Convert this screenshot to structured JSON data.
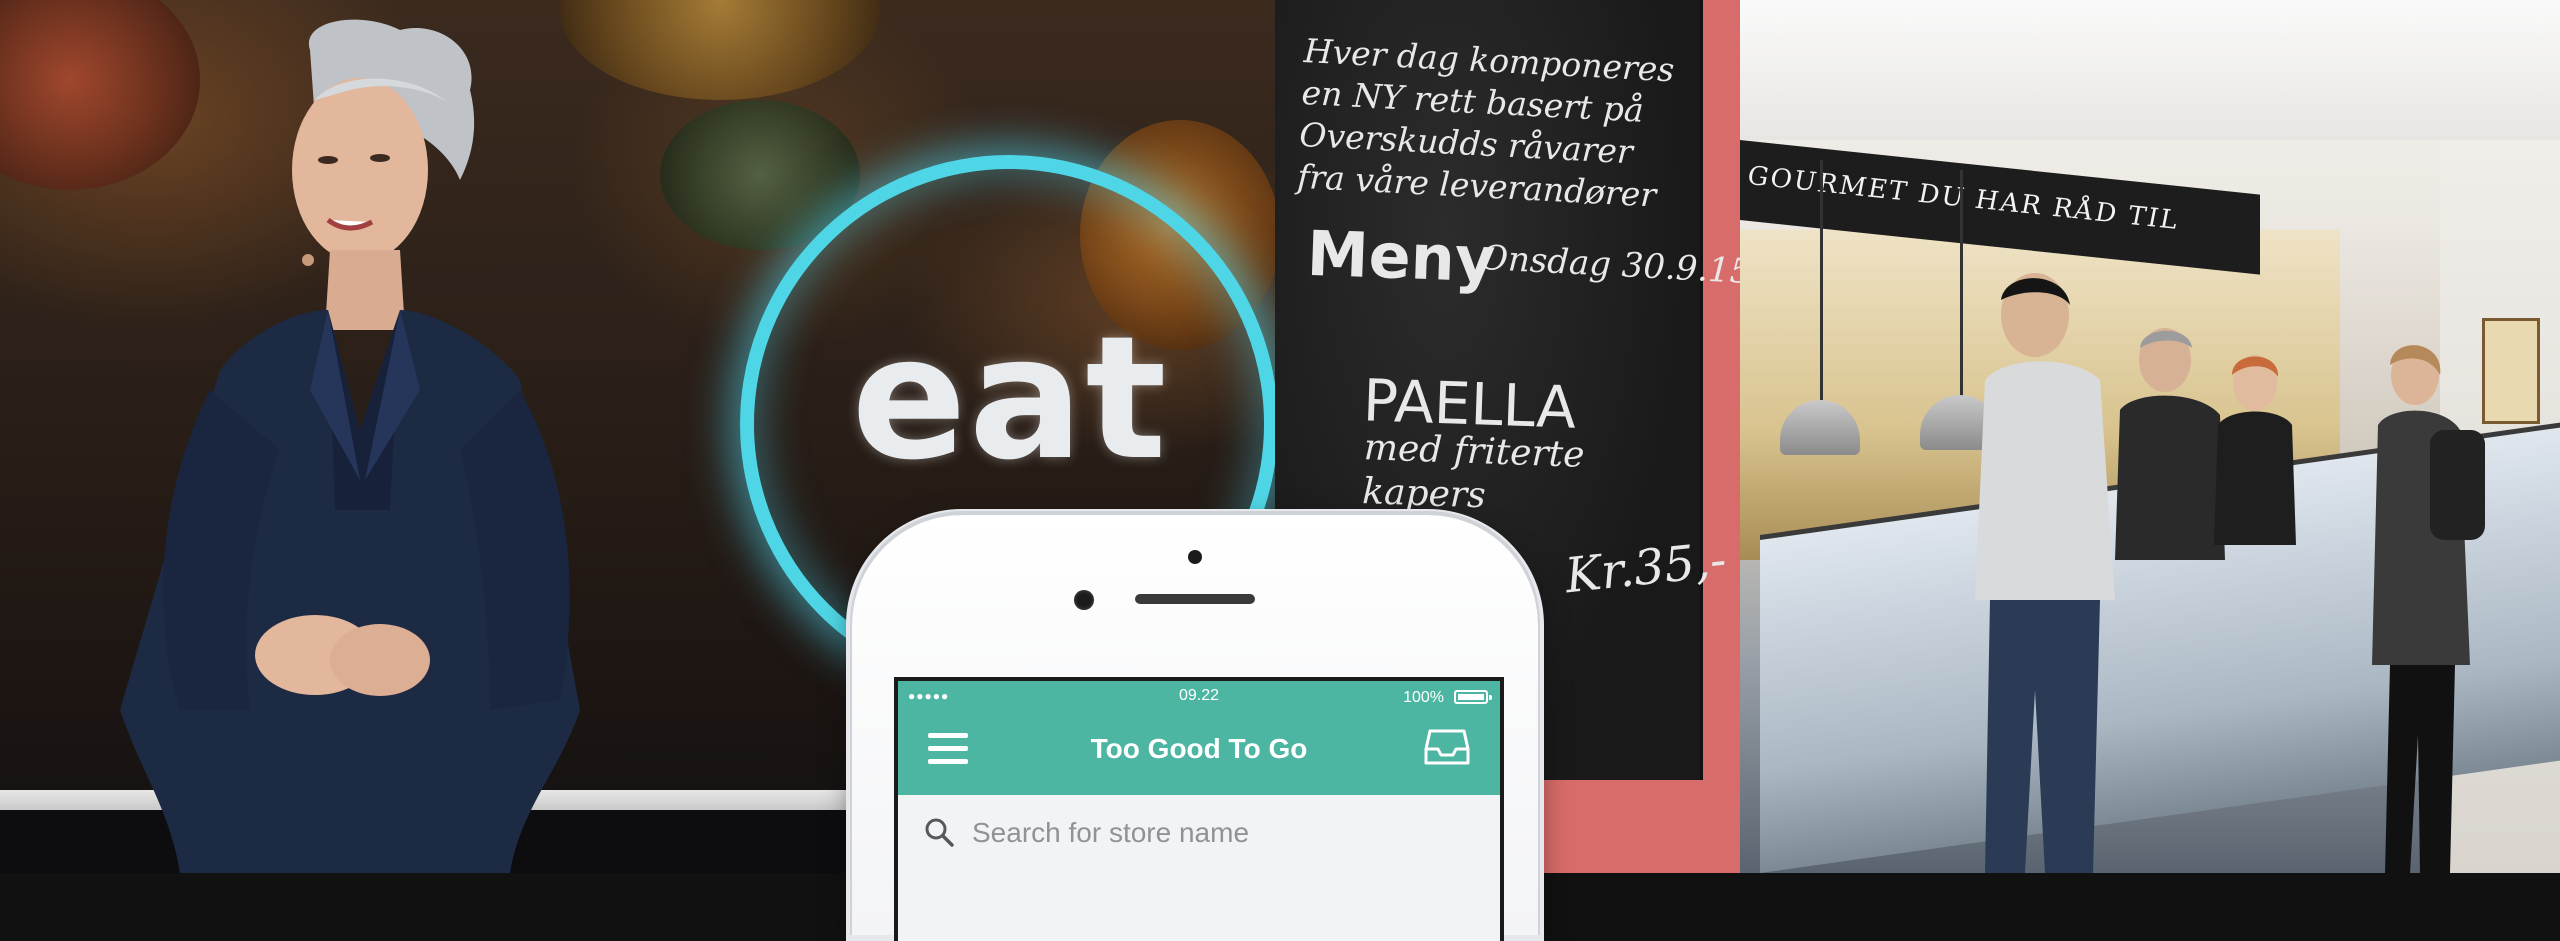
{
  "stage": {
    "logo_text": "eat"
  },
  "chalkboard": {
    "intro_lines": [
      "Hver dag komponeres",
      "en NY rett basert på",
      "Overskudds råvarer",
      "fra våre leverandører"
    ],
    "menu_heading": "Meny",
    "date": "Onsdag 30.9.15",
    "dish": "PAELLA",
    "dish_lines": [
      "med friterte",
      "kapers"
    ],
    "price": "Kr.35,-"
  },
  "cafe": {
    "sign_text": "GOURMET  DU HAR RÅD TIL"
  },
  "phone": {
    "status": {
      "signal": "●●●●●",
      "time": "09.22",
      "battery": "100%",
      "battery_level": 1.0
    },
    "app_title": "Too Good To Go",
    "search_placeholder": "Search for store name",
    "icons": {
      "menu": "hamburger-menu-icon",
      "inbox": "inbox-tray-icon",
      "search": "search-icon"
    },
    "colors": {
      "appbar": "#4db6a2",
      "searchbar": "#f2f3f4"
    }
  }
}
